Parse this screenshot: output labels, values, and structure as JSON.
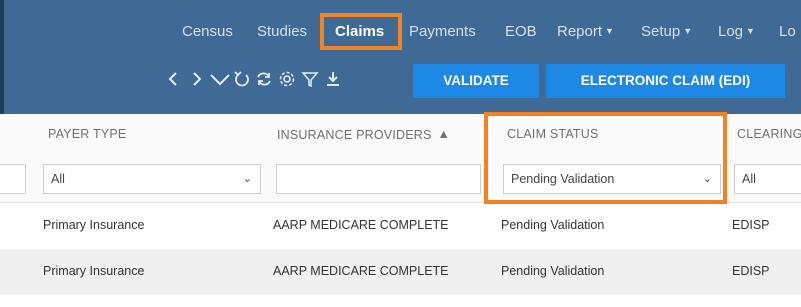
{
  "nav": {
    "items": [
      "Census",
      "Studies",
      "Claims",
      "Payments",
      "EOB",
      "Report",
      "Setup",
      "Log",
      "Lo"
    ],
    "active": "Claims"
  },
  "toolbar": {
    "icons": [
      "chevron-left-icon",
      "chevron-right-icon",
      "chevron-down-icon",
      "undo-icon",
      "refresh-icon",
      "settings-icon",
      "filter-icon",
      "download-icon"
    ],
    "validate_label": "VALIDATE",
    "edi_label": "ELECTRONIC CLAIM (EDI)"
  },
  "grid": {
    "columns": [
      "PAYER TYPE",
      "INSURANCE PROVIDERS",
      "CLAIM STATUS",
      "CLEARING"
    ],
    "filters": {
      "payer_type": "All",
      "insurance_providers": "",
      "claim_status": "Pending Validation",
      "clearing": "All"
    },
    "rows": [
      [
        "Primary Insurance",
        "AARP MEDICARE COMPLETE",
        "Pending Validation",
        "EDISP"
      ],
      [
        "Primary Insurance",
        "AARP MEDICARE COMPLETE",
        "Pending Validation",
        "EDISP"
      ]
    ]
  },
  "colors": {
    "header_bg": "#3e6a95",
    "button_bg": "#1e88e5",
    "highlight": "#f58220"
  }
}
